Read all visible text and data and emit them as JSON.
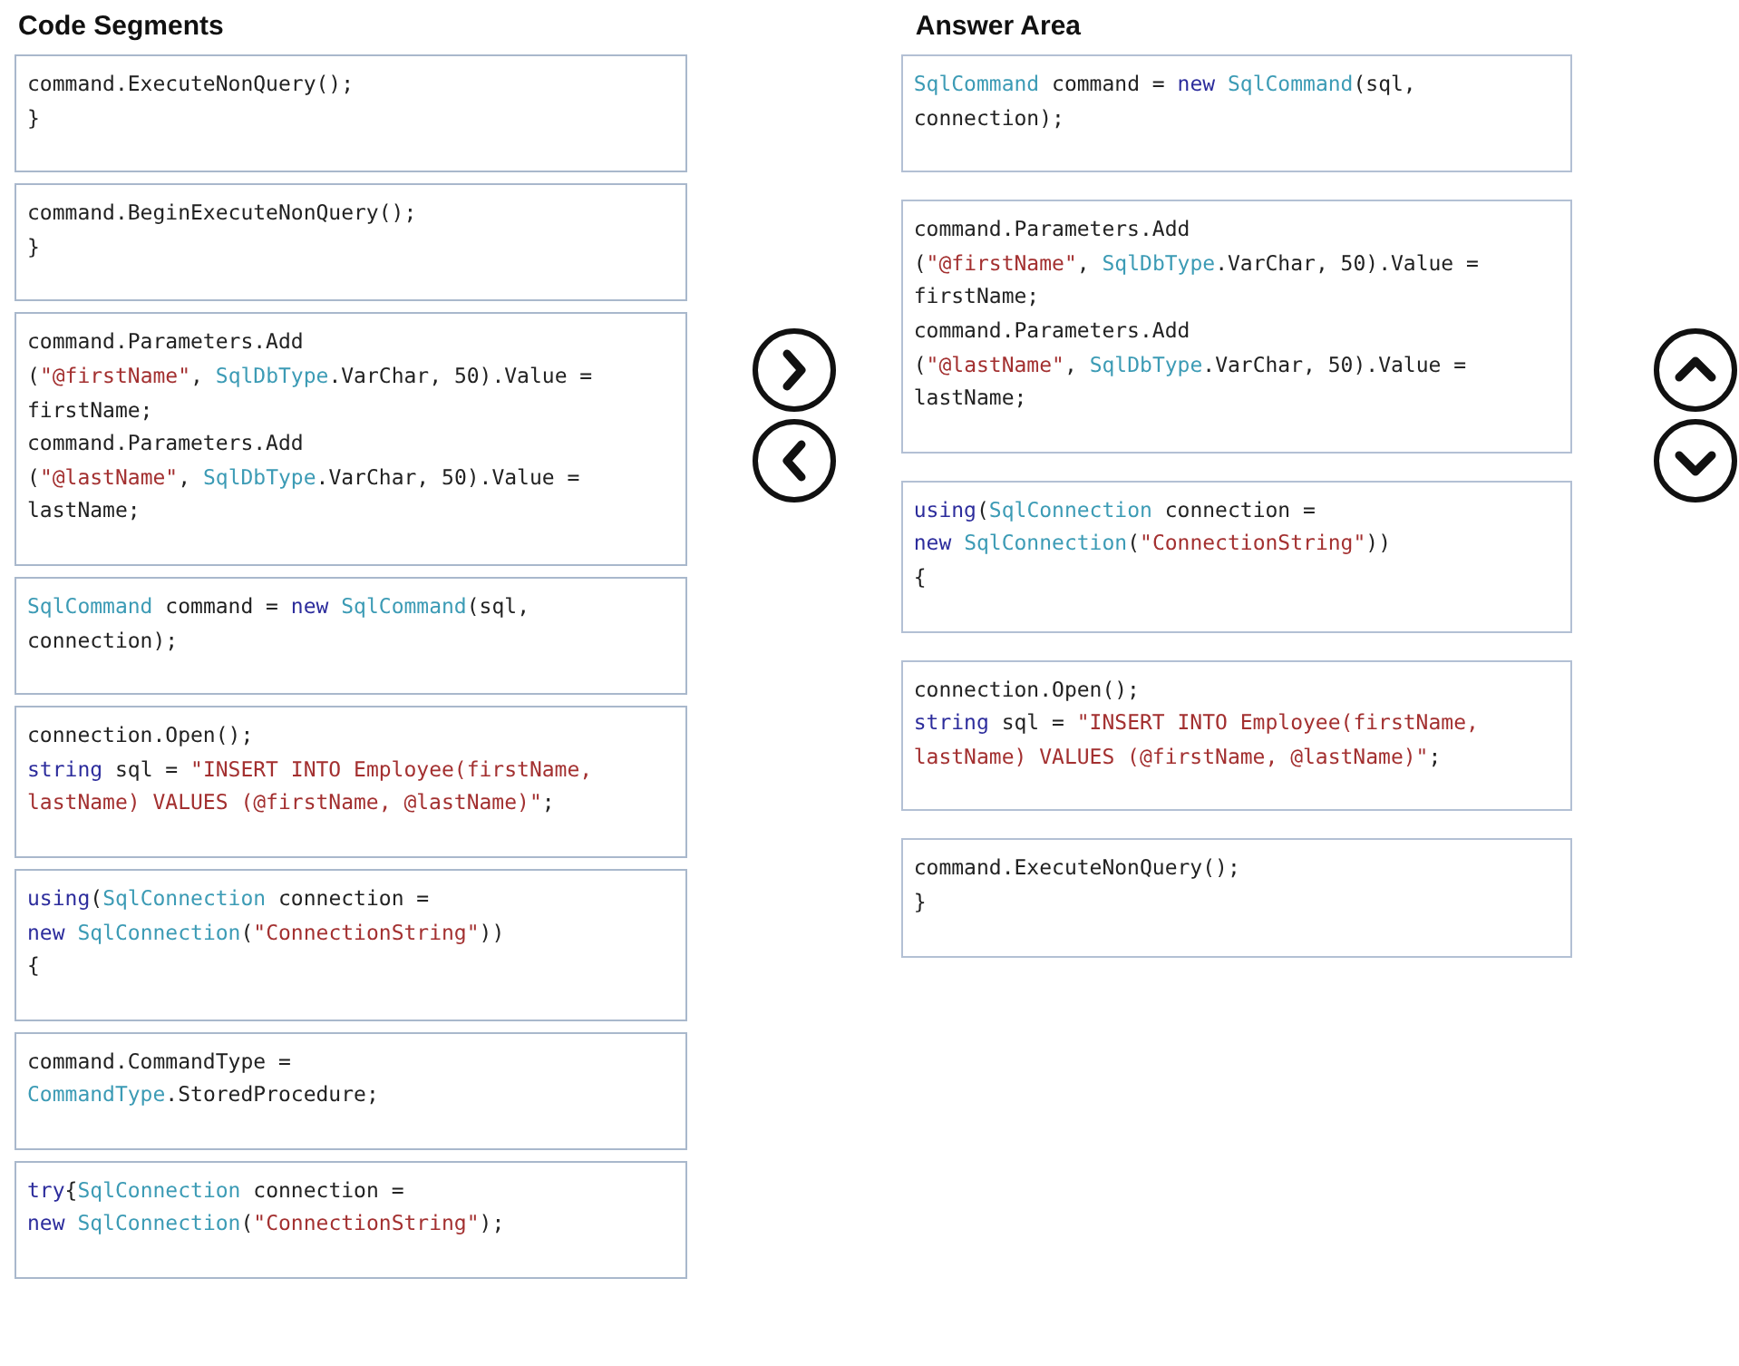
{
  "code_segments": {
    "title": "Code Segments",
    "items": [
      {
        "lines": [
          [
            {
              "kind": "plain",
              "text": "command.ExecuteNonQuery();"
            }
          ],
          [
            {
              "kind": "plain",
              "text": "}"
            }
          ]
        ]
      },
      {
        "lines": [
          [
            {
              "kind": "plain",
              "text": "command.BeginExecuteNonQuery();"
            }
          ],
          [
            {
              "kind": "plain",
              "text": "}"
            }
          ]
        ]
      },
      {
        "lines": [
          [
            {
              "kind": "plain",
              "text": "command.Parameters.Add"
            }
          ],
          [
            {
              "kind": "plain",
              "text": "("
            },
            {
              "kind": "string",
              "text": "\"@firstName\""
            },
            {
              "kind": "plain",
              "text": ", "
            },
            {
              "kind": "type",
              "text": "SqlDbType"
            },
            {
              "kind": "plain",
              "text": ".VarChar, 50).Value ="
            }
          ],
          [
            {
              "kind": "plain",
              "text": "firstName;"
            }
          ],
          [
            {
              "kind": "plain",
              "text": "command.Parameters.Add"
            }
          ],
          [
            {
              "kind": "plain",
              "text": "("
            },
            {
              "kind": "string",
              "text": "\"@lastName\""
            },
            {
              "kind": "plain",
              "text": ", "
            },
            {
              "kind": "type",
              "text": "SqlDbType"
            },
            {
              "kind": "plain",
              "text": ".VarChar, 50).Value ="
            }
          ],
          [
            {
              "kind": "plain",
              "text": "lastName;"
            }
          ]
        ]
      },
      {
        "lines": [
          [
            {
              "kind": "type",
              "text": "SqlCommand"
            },
            {
              "kind": "plain",
              "text": " command = "
            },
            {
              "kind": "keyword",
              "text": "new "
            },
            {
              "kind": "type",
              "text": "SqlCommand"
            },
            {
              "kind": "plain",
              "text": "(sql,"
            }
          ],
          [
            {
              "kind": "plain",
              "text": "connection);"
            }
          ]
        ]
      },
      {
        "lines": [
          [
            {
              "kind": "plain",
              "text": "connection.Open();"
            }
          ],
          [
            {
              "kind": "keyword",
              "text": "string"
            },
            {
              "kind": "plain",
              "text": " sql = "
            },
            {
              "kind": "string",
              "text": "\"INSERT INTO Employee(firstName,"
            }
          ],
          [
            {
              "kind": "string",
              "text": "lastName) VALUES (@firstName, @lastName)\""
            },
            {
              "kind": "plain",
              "text": ";"
            }
          ]
        ]
      },
      {
        "lines": [
          [
            {
              "kind": "keyword",
              "text": "using"
            },
            {
              "kind": "plain",
              "text": "("
            },
            {
              "kind": "type",
              "text": "SqlConnection"
            },
            {
              "kind": "plain",
              "text": " connection ="
            }
          ],
          [
            {
              "kind": "keyword",
              "text": "new "
            },
            {
              "kind": "type",
              "text": "SqlConnection"
            },
            {
              "kind": "plain",
              "text": "("
            },
            {
              "kind": "string",
              "text": "\"ConnectionString\""
            },
            {
              "kind": "plain",
              "text": "))"
            }
          ],
          [
            {
              "kind": "plain",
              "text": "{"
            }
          ]
        ]
      },
      {
        "lines": [
          [
            {
              "kind": "plain",
              "text": "command.CommandType ="
            }
          ],
          [
            {
              "kind": "type",
              "text": "CommandType"
            },
            {
              "kind": "plain",
              "text": ".StoredProcedure;"
            }
          ]
        ]
      },
      {
        "lines": [
          [
            {
              "kind": "keyword",
              "text": "try"
            },
            {
              "kind": "plain",
              "text": "{"
            },
            {
              "kind": "type",
              "text": "SqlConnection"
            },
            {
              "kind": "plain",
              "text": " connection ="
            }
          ],
          [
            {
              "kind": "keyword",
              "text": "new "
            },
            {
              "kind": "type",
              "text": "SqlConnection"
            },
            {
              "kind": "plain",
              "text": "("
            },
            {
              "kind": "string",
              "text": "\"ConnectionString\""
            },
            {
              "kind": "plain",
              "text": ");"
            }
          ]
        ]
      }
    ]
  },
  "move_buttons": [
    {
      "kind": "right"
    },
    {
      "kind": "left"
    }
  ],
  "answer_area": {
    "title": "Answer Area",
    "items": [
      {
        "lines": [
          [
            {
              "kind": "type",
              "text": "SqlCommand"
            },
            {
              "kind": "plain",
              "text": " command = "
            },
            {
              "kind": "keyword",
              "text": "new "
            },
            {
              "kind": "type",
              "text": "SqlCommand"
            },
            {
              "kind": "plain",
              "text": "(sql,"
            }
          ],
          [
            {
              "kind": "plain",
              "text": "connection);"
            }
          ]
        ]
      },
      {
        "lines": [
          [
            {
              "kind": "plain",
              "text": "command.Parameters.Add"
            }
          ],
          [
            {
              "kind": "plain",
              "text": "("
            },
            {
              "kind": "string",
              "text": "\"@firstName\""
            },
            {
              "kind": "plain",
              "text": ", "
            },
            {
              "kind": "type",
              "text": "SqlDbType"
            },
            {
              "kind": "plain",
              "text": ".VarChar, 50).Value ="
            }
          ],
          [
            {
              "kind": "plain",
              "text": "firstName;"
            }
          ],
          [
            {
              "kind": "plain",
              "text": "command.Parameters.Add"
            }
          ],
          [
            {
              "kind": "plain",
              "text": "("
            },
            {
              "kind": "string",
              "text": "\"@lastName\""
            },
            {
              "kind": "plain",
              "text": ", "
            },
            {
              "kind": "type",
              "text": "SqlDbType"
            },
            {
              "kind": "plain",
              "text": ".VarChar, 50).Value ="
            }
          ],
          [
            {
              "kind": "plain",
              "text": "lastName;"
            }
          ]
        ]
      },
      {
        "lines": [
          [
            {
              "kind": "keyword",
              "text": "using"
            },
            {
              "kind": "plain",
              "text": "("
            },
            {
              "kind": "type",
              "text": "SqlConnection"
            },
            {
              "kind": "plain",
              "text": " connection ="
            }
          ],
          [
            {
              "kind": "keyword",
              "text": "new "
            },
            {
              "kind": "type",
              "text": "SqlConnection"
            },
            {
              "kind": "plain",
              "text": "("
            },
            {
              "kind": "string",
              "text": "\"ConnectionString\""
            },
            {
              "kind": "plain",
              "text": "))"
            }
          ],
          [
            {
              "kind": "plain",
              "text": "{"
            }
          ]
        ]
      },
      {
        "lines": [
          [
            {
              "kind": "plain",
              "text": "connection.Open();"
            }
          ],
          [
            {
              "kind": "keyword",
              "text": "string"
            },
            {
              "kind": "plain",
              "text": " sql = "
            },
            {
              "kind": "string",
              "text": "\"INSERT INTO Employee(firstName,"
            }
          ],
          [
            {
              "kind": "string",
              "text": "lastName) VALUES (@firstName, @lastName)\""
            },
            {
              "kind": "plain",
              "text": ";"
            }
          ]
        ]
      },
      {
        "lines": [
          [
            {
              "kind": "plain",
              "text": "command.ExecuteNonQuery();"
            }
          ],
          [
            {
              "kind": "plain",
              "text": "}"
            }
          ]
        ]
      }
    ]
  },
  "order_buttons": [
    {
      "kind": "up"
    },
    {
      "kind": "down"
    }
  ]
}
